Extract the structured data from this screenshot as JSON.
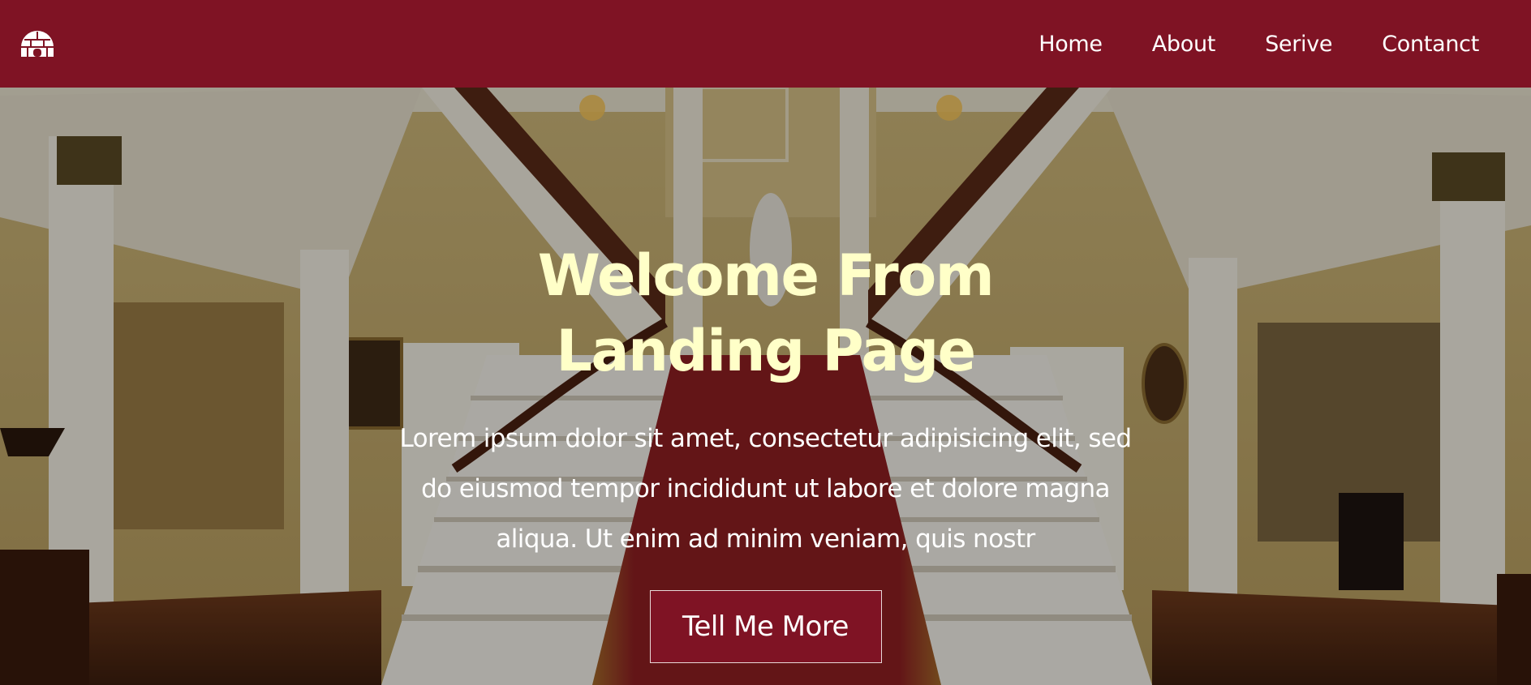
{
  "navbar": {
    "logo_icon": "igloo-icon",
    "background": "#7f1324",
    "links": [
      {
        "label": "Home"
      },
      {
        "label": "About"
      },
      {
        "label": "Serive"
      },
      {
        "label": "Contanct"
      }
    ]
  },
  "hero": {
    "background_icon": "grand-staircase-photo",
    "title": "Welcome From Landing Page",
    "text": "Lorem ipsum dolor sit amet, consectetur adipisicing elit, sed do eiusmod tempor incididunt ut labore et dolore magna aliqua. Ut enim ad minim veniam, quis nostr",
    "button_label": "Tell Me More",
    "title_color": "#ffffc8",
    "accent": "#7f1324"
  }
}
